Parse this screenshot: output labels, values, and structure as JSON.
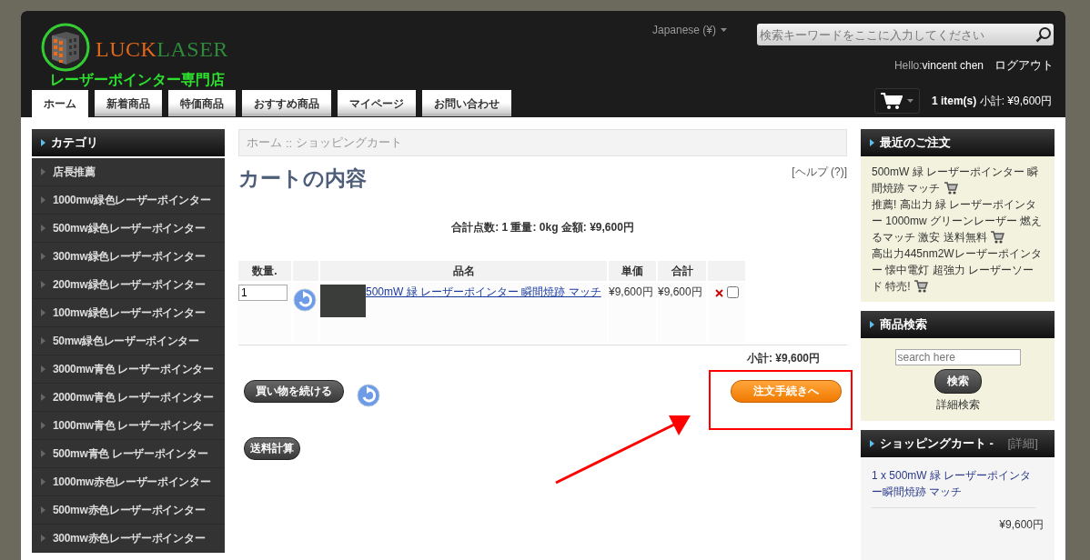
{
  "header": {
    "logo": {
      "brand_first": "LUCK",
      "brand_second": "LASER",
      "tagline": "レーザーポインター専門店"
    },
    "language": "Japanese (¥)",
    "search": {
      "placeholder": "検索キーワードをここに入力してください"
    },
    "greeting": "Hello:",
    "user": "vincent chen",
    "logout": "ログアウト",
    "cart_summary": {
      "count": "1 item(s)",
      "subtotal": "小計: ¥9,600円"
    }
  },
  "nav_tabs": [
    {
      "label": "ホーム",
      "selected": true
    },
    {
      "label": "新着商品",
      "selected": false
    },
    {
      "label": "特価商品",
      "selected": false
    },
    {
      "label": "おすすめ商品",
      "selected": false
    },
    {
      "label": "マイページ",
      "selected": false
    },
    {
      "label": "お問い合わせ",
      "selected": false
    }
  ],
  "sidebar": {
    "title": "カテゴリ",
    "items": [
      "店長推薦",
      "1000mw緑色レーザーポインター",
      "500mw緑色レーザーポインター",
      "300mw緑色レーザーポインター",
      "200mw緑色レーザーポインター",
      "100mw緑色レーザーポインター",
      "50mw緑色レーザーポインター",
      "3000mw青色 レーザーポインター",
      "2000mw青色 レーザーポインター",
      "1000mw青色 レーザーポインター",
      "500mw青色 レーザーポインター",
      "1000mw赤色レーザーポインター",
      "500mw赤色レーザーポインター",
      "300mw赤色レーザーポインター"
    ]
  },
  "breadcrumb": {
    "items": [
      "ホーム",
      "ショッピングカート"
    ],
    "separator": "::"
  },
  "cart": {
    "title": "カートの内容",
    "help": "[ヘルプ (?)]",
    "summary": "合計点数: 1  重量: 0kg  金額: ¥9,600円",
    "columns": [
      {
        "kind": "text",
        "label": "数量."
      },
      {
        "kind": "blank"
      },
      {
        "kind": "text",
        "label": "品名"
      },
      {
        "kind": "text",
        "label": "単価"
      },
      {
        "kind": "text",
        "label": "合計"
      },
      {
        "kind": "blank"
      }
    ],
    "rows": [
      {
        "quantity": "1",
        "product": "500mW 緑 レーザーポインター 瞬間焼跡 マッチ",
        "unit_price": "¥9,600円",
        "total": "¥9,600円",
        "remove_checked": false
      }
    ],
    "subtotal": "小計: ¥9,600円",
    "continue_button": "買い物を続ける",
    "checkout_button": "注文手続きへ",
    "shipping_button": "送料計算"
  },
  "recent_orders": {
    "title": "最近のご注文",
    "items": [
      "500mW 緑 レーザーポインター 瞬間焼跡 マッチ",
      "推薦! 高出力 緑 レーザーポインター 1000mw グリーンレーザー 燃えるマッチ 激安 送料無料",
      "高出力445nm2Wレーザーポインター 懐中電灯 超強力 レーザーソード 特売!"
    ]
  },
  "product_search": {
    "title": "商品検索",
    "placeholder": "search here",
    "button": "検索",
    "advanced": "詳細検索"
  },
  "cart_box": {
    "title": "ショッピングカート -",
    "details": "[詳細]",
    "items": [
      "1 x 500mW 緑 レーザーポインター瞬間焼跡 マッチ"
    ],
    "total": "¥9,600円"
  }
}
